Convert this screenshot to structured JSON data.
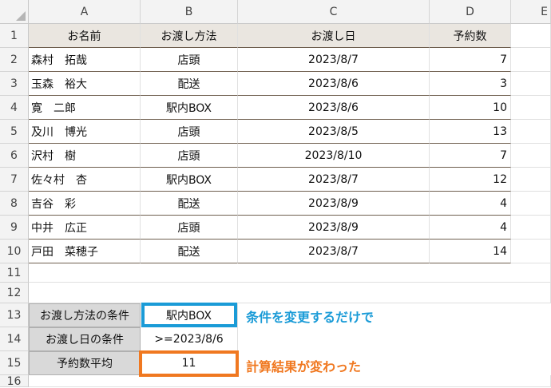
{
  "columns": [
    "A",
    "B",
    "C",
    "D",
    "E"
  ],
  "rows": [
    "1",
    "2",
    "3",
    "4",
    "5",
    "6",
    "7",
    "8",
    "9",
    "10",
    "11",
    "12",
    "13",
    "14",
    "15",
    "16"
  ],
  "table": {
    "headers": [
      "お名前",
      "お渡し方法",
      "お渡し日",
      "予約数"
    ],
    "rows": [
      [
        "森村　拓哉",
        "店頭",
        "2023/8/7",
        "7"
      ],
      [
        "玉森　裕大",
        "配送",
        "2023/8/6",
        "3"
      ],
      [
        "寛　二郎",
        "駅内BOX",
        "2023/8/6",
        "10"
      ],
      [
        "及川　博光",
        "店頭",
        "2023/8/5",
        "13"
      ],
      [
        "沢村　樹",
        "店頭",
        "2023/8/10",
        "7"
      ],
      [
        "佐々村　杏",
        "駅内BOX",
        "2023/8/7",
        "12"
      ],
      [
        "吉谷　彩",
        "配送",
        "2023/8/9",
        "4"
      ],
      [
        "中井　広正",
        "店頭",
        "2023/8/9",
        "4"
      ],
      [
        "戸田　菜穂子",
        "配送",
        "2023/8/7",
        "14"
      ]
    ]
  },
  "criteria": {
    "method_label": "お渡し方法の条件",
    "method_value": "駅内BOX",
    "date_label": "お渡し日の条件",
    "date_value": ">=2023/8/6",
    "avg_label": "予約数平均",
    "avg_value": "11"
  },
  "annotations": {
    "change_condition": "条件を変更するだけで",
    "result_changed": "計算結果が変わった"
  },
  "colors": {
    "blue_box": "#1a9bd7",
    "orange_box": "#f07820",
    "header_fill": "#eae6e0",
    "label_fill": "#d9d9d9"
  }
}
